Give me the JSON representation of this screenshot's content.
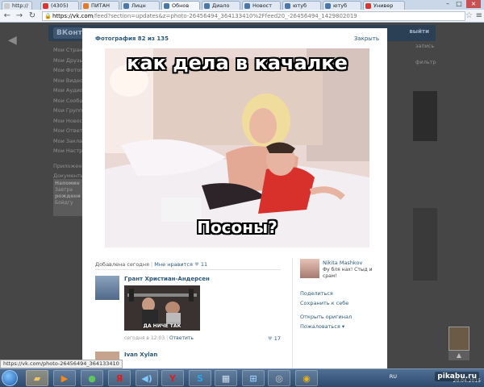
{
  "browser": {
    "tabs": [
      {
        "label": "http://"
      },
      {
        "label": "(4305)"
      },
      {
        "label": "ПИТАН"
      },
      {
        "label": "Лицн"
      },
      {
        "label": "Обнов"
      },
      {
        "label": "Диало"
      },
      {
        "label": "Новост"
      },
      {
        "label": "ютуб"
      },
      {
        "label": "ютуб"
      },
      {
        "label": "Универ"
      }
    ],
    "url_host": "https://vk.com",
    "url_rest": "/feed?section=updates&z=photo-26456494_364133410%2Ffeed20_-26456494_1429802019",
    "status_url": "https://vk.com/photo-26456494_364133410"
  },
  "background": {
    "logo": "ВКонт",
    "exit": "выйти",
    "sidebar": [
      "Мои Стран",
      "Мои Друзь",
      "Мои Фотог",
      "Мои Видео",
      "Мои Аудио",
      "Мои Сообщ",
      "Мои Групп",
      "Мои Новос",
      "Мои Ответ",
      "Мои Заклад",
      "Мои Настро",
      "Приложени",
      "Документы"
    ],
    "reminder": [
      "Напомин",
      "Завтра",
      "рождени",
      "Бойдгу"
    ],
    "right": [
      "запись",
      "фильтр"
    ]
  },
  "viewer": {
    "counter": "Фотография 82 из 135",
    "close": "Закрыть",
    "caption_top": "как дела в качалке",
    "caption_bottom": "Посоны?",
    "added": "Добавлена сегодня",
    "like_label": "Мне нравится",
    "like_count": "11"
  },
  "comments": [
    {
      "name": "Грант Христиан-Андерсен",
      "image_caption": "ДА НИЧЕ ТАК",
      "time": "сегодня в 12:03",
      "reply": "Ответить",
      "likes": "17"
    },
    {
      "name": "Ivan Xylan",
      "image_caption": "",
      "time": "",
      "reply": "",
      "likes": ""
    }
  ],
  "author": {
    "name": "Nikita Mashkov",
    "text": "Фу бля нах! Стыд и срам!"
  },
  "actions": {
    "share": "Поделиться",
    "save": "Сохранить к себе",
    "open": "Открыть оригинал",
    "report": "Пожаловаться"
  },
  "taskbar": {
    "lang": "RU",
    "date": "20.04.2015",
    "watermark": "pikabu.ru"
  },
  "colors": {
    "vk_link": "#2b587a",
    "vk_header": "#2b3f55",
    "overlay": "#3d3d3d"
  }
}
